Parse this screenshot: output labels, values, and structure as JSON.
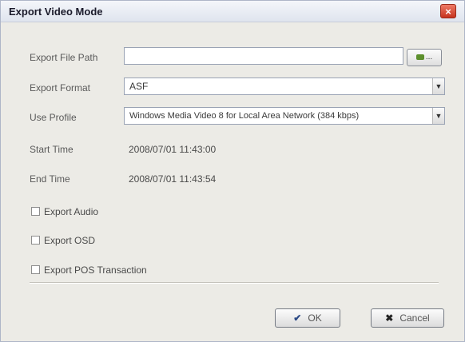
{
  "window": {
    "title": "Export Video Mode"
  },
  "form": {
    "file_path": {
      "label": "Export File Path",
      "value": ""
    },
    "format": {
      "label": "Export Format",
      "value": "ASF"
    },
    "profile": {
      "label": "Use Profile",
      "value": "Windows Media Video 8 for Local Area Network (384 kbps)"
    },
    "start_time": {
      "label": "Start Time",
      "value": "2008/07/01 11:43:00"
    },
    "end_time": {
      "label": "End Time",
      "value": "2008/07/01 11:43:54"
    }
  },
  "browse_button": {
    "label": "...",
    "icon": "folder-icon"
  },
  "options": [
    {
      "label": "Export Audio",
      "checked": false
    },
    {
      "label": "Export OSD",
      "checked": false
    },
    {
      "label": "Export POS Transaction",
      "checked": false
    }
  ],
  "buttons": {
    "ok": {
      "label": "OK",
      "icon": "checkmark-icon"
    },
    "cancel": {
      "label": "Cancel",
      "icon": "x-icon"
    }
  },
  "colors": {
    "close_button": "#d9442e",
    "window_bg": "#ecebe6",
    "field_border": "#9aa3b4"
  }
}
